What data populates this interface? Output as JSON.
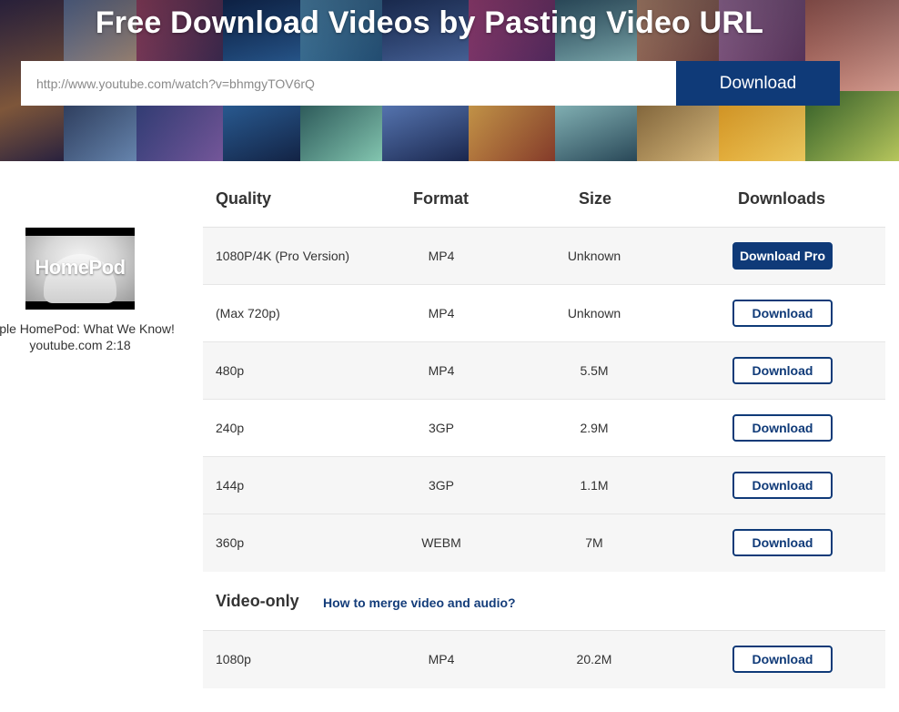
{
  "hero": {
    "title": "Free Download Videos by Pasting Video URL",
    "input_value": "http://www.youtube.com/watch?v=bhmgyTOV6rQ",
    "button_label": "Download"
  },
  "video": {
    "thumbnail_text": "HomePod",
    "title": "Apple HomePod: What We Know!",
    "meta": "youtube.com 2:18"
  },
  "table": {
    "headers": [
      "Quality",
      "Format",
      "Size",
      "Downloads"
    ],
    "rows": [
      {
        "quality": "1080P/4K (Pro Version)",
        "format": "MP4",
        "size": "Unknown",
        "action": "Download Pro"
      },
      {
        "quality": "(Max 720p)",
        "format": "MP4",
        "size": "Unknown",
        "action": "Download"
      },
      {
        "quality": "480p",
        "format": "MP4",
        "size": "5.5M",
        "action": "Download"
      },
      {
        "quality": "240p",
        "format": "3GP",
        "size": "2.9M",
        "action": "Download"
      },
      {
        "quality": "144p",
        "format": "3GP",
        "size": "1.1M",
        "action": "Download"
      },
      {
        "quality": "360p",
        "format": "WEBM",
        "size": "7M",
        "action": "Download"
      }
    ],
    "video_only": {
      "title": "Video-only",
      "link": "How to merge video and audio?",
      "rows": [
        {
          "quality": "1080p",
          "format": "MP4",
          "size": "20.2M",
          "action": "Download"
        }
      ]
    }
  },
  "colors": {
    "accent": "#0f3a78",
    "row_shade": "#f6f6f6"
  }
}
